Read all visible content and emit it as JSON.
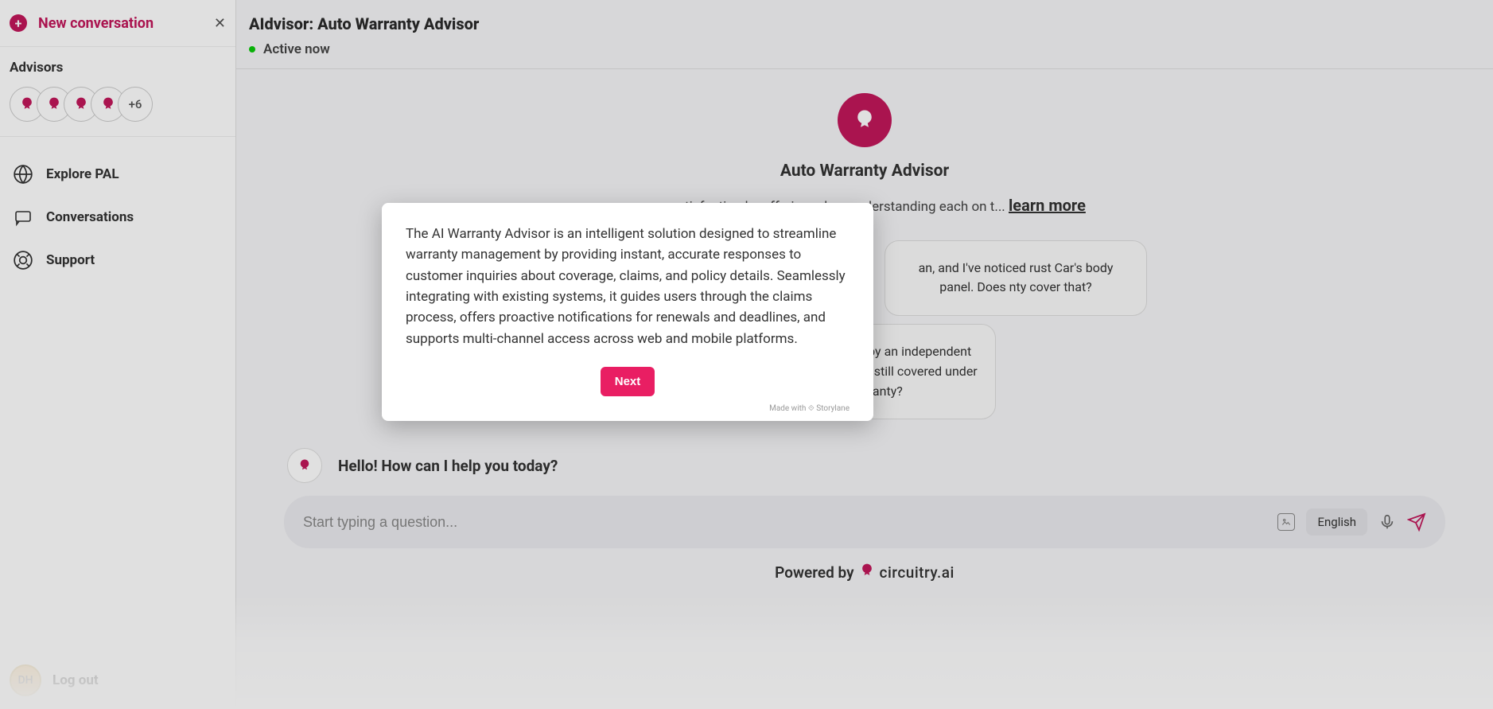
{
  "sidebar": {
    "new_conversation_label": "New conversation",
    "advisors_label": "Advisors",
    "advisor_more_count": "+6",
    "nav": {
      "explore": "Explore PAL",
      "conversations": "Conversations",
      "support": "Support"
    },
    "user_initials": "DH",
    "logout_label": "Log out"
  },
  "header": {
    "title": "AIdvisor: Auto Warranty Advisor",
    "status_text": "Active now"
  },
  "hero": {
    "title": "Auto Warranty Advisor",
    "description_visible": "mer satisfaction by offering ed on understanding each on t... ",
    "learn_more": "learn more"
  },
  "samples": {
    "card1": "an, and I've noticed rust Car's body panel. Does nty cover that?",
    "card2": "and had it installed by an independent mechanic. Is the part still covered under the warranty?"
  },
  "greeting": "Hello! How can I help you today?",
  "input": {
    "placeholder": "Start typing a question...",
    "language": "English"
  },
  "powered_by": {
    "prefix": "Powered by",
    "brand": "circuitry.ai"
  },
  "modal": {
    "body": "The AI Warranty Advisor is an intelligent solution designed to streamline warranty management by providing instant, accurate responses to customer inquiries about coverage, claims, and policy details. Seamlessly integrating with existing systems, it guides users through the claims process, offers proactive notifications for renewals and deadlines, and supports multi-channel access across web and mobile platforms.",
    "next_label": "Next",
    "made_with": "Made with",
    "storylane": "Storylane"
  }
}
